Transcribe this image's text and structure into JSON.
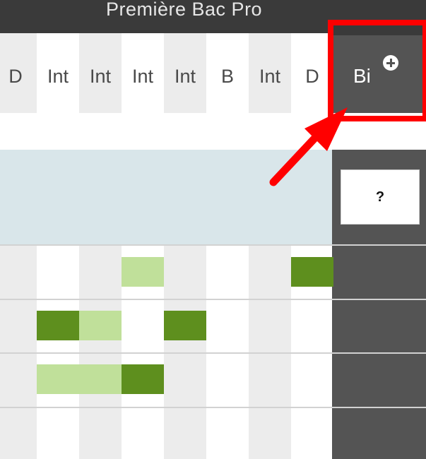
{
  "header": {
    "section_title": "Première Bac Pro"
  },
  "columns": [
    {
      "label": "D",
      "shaded": true
    },
    {
      "label": "Int",
      "shaded": false
    },
    {
      "label": "Int",
      "shaded": true
    },
    {
      "label": "Int",
      "shaded": false
    },
    {
      "label": "Int",
      "shaded": true
    },
    {
      "label": "B",
      "shaded": false
    },
    {
      "label": "Int",
      "shaded": true
    },
    {
      "label": "D",
      "shaded": false
    }
  ],
  "highlighted_column": {
    "label": "Bi",
    "action_icon": "plus-circle-icon",
    "input_value": "?"
  },
  "rows": [
    {
      "cells": [
        "",
        "",
        "",
        "light",
        "",
        "",
        "",
        "dark"
      ]
    },
    {
      "cells": [
        "",
        "dark",
        "light",
        "",
        "dark",
        "",
        "",
        ""
      ]
    },
    {
      "cells": [
        "",
        "light",
        "light",
        "dark",
        "",
        "",
        "",
        ""
      ]
    },
    {
      "cells": [
        "",
        "",
        "",
        "",
        "",
        "",
        "",
        ""
      ]
    }
  ],
  "colors": {
    "dark_green": "#5e8f1e",
    "light_green": "#c0e09a",
    "highlight_red": "#ff0000",
    "panel_gray": "#545454",
    "header_dark": "#3a3a3a",
    "blue_band": "#d9e6ea"
  }
}
